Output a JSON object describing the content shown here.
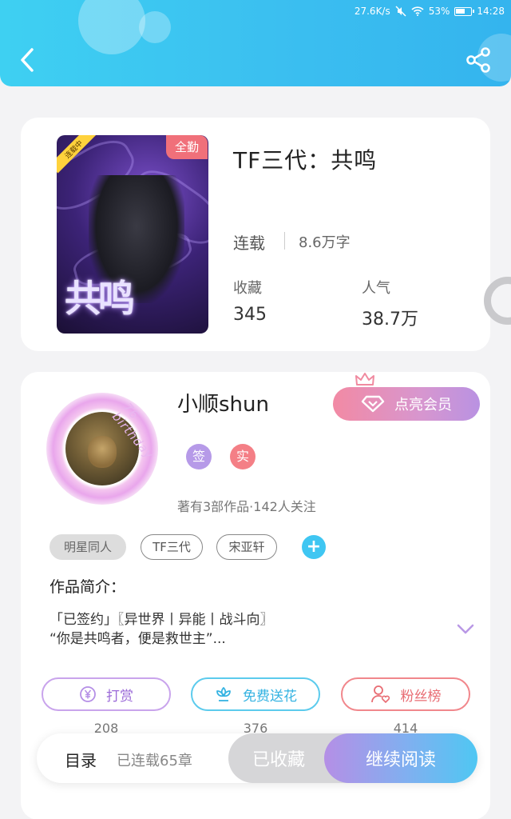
{
  "status_bar": {
    "speed": "27.6K/s",
    "battery": "53%",
    "time": "14:28"
  },
  "header": {
    "back_icon": "back-arrow-icon",
    "share_icon": "share-icon"
  },
  "book": {
    "cover_title": "共鸣",
    "cover_serial_tag": "连载中",
    "badge": "全勤",
    "title": "TF三代：共鸣",
    "status": "连载",
    "words": "8.6万字",
    "favorites_label": "收藏",
    "favorites_value": "345",
    "popularity_label": "人气",
    "popularity_value": "38.7万"
  },
  "author": {
    "avatar_deco_text": "76 birthday",
    "name": "小顺shun",
    "vip_button": "点亮会员",
    "badge_signed": "签",
    "badge_verified": "实",
    "stats": "著有3部作品·142人关注",
    "tags": [
      "明星同人",
      "TF三代",
      "宋亚轩"
    ],
    "add_tag": "+"
  },
  "intro": {
    "label": "作品简介：",
    "line1": "「已签约」〖异世界丨异能丨战斗向〗",
    "line2": "“你是共鸣者，便是救世主”..."
  },
  "actions": {
    "reward_label": "打赏",
    "reward_count": "208",
    "flower_label": "免费送花",
    "flower_count": "376",
    "fans_label": "粉丝榜",
    "fans_count": "414"
  },
  "bottom": {
    "toc_label": "目录",
    "toc_count": "已连载65章",
    "collected_label": "已收藏",
    "read_label": "继续阅读"
  },
  "colors": {
    "header_blue": "#3bbff0",
    "vip_pink": "#f28aa4",
    "accent_purple": "#b58fe6",
    "badge_red": "#f0707a"
  }
}
